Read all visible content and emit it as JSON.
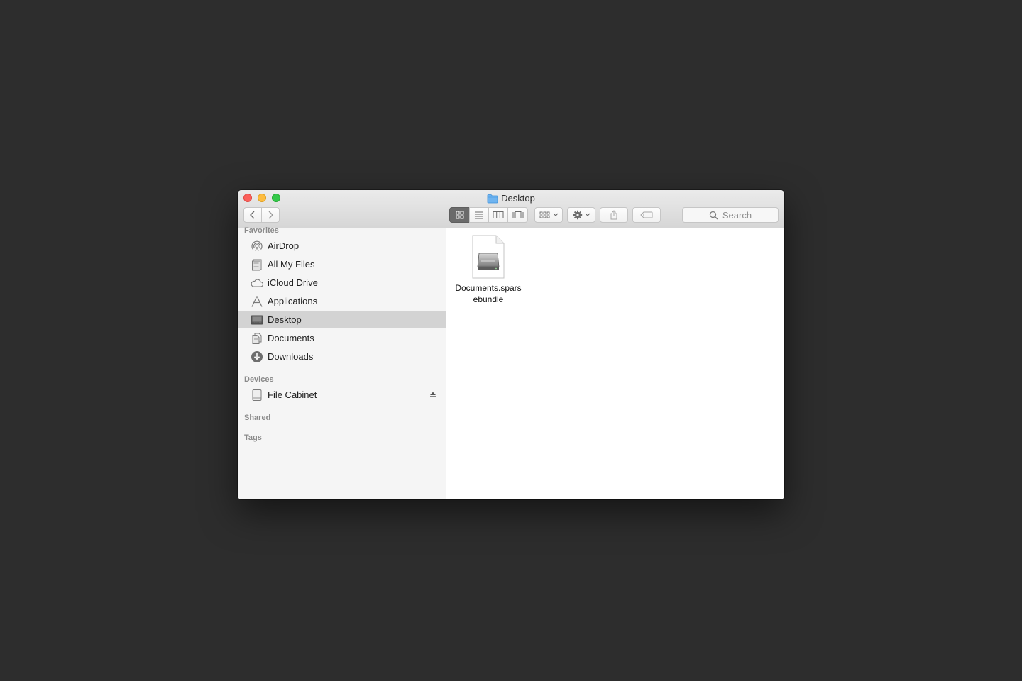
{
  "window": {
    "title": "Desktop",
    "search_placeholder": "Search"
  },
  "toolbar": {
    "view_modes": [
      "icon-view",
      "list-view",
      "column-view",
      "cover-flow-view"
    ],
    "active_view": "icon-view"
  },
  "sidebar": {
    "favorites_header": "Favorites",
    "favorites": [
      {
        "label": "AirDrop",
        "icon": "airdrop-icon"
      },
      {
        "label": "All My Files",
        "icon": "all-my-files-icon"
      },
      {
        "label": "iCloud Drive",
        "icon": "cloud-icon"
      },
      {
        "label": "Applications",
        "icon": "applications-icon"
      },
      {
        "label": "Desktop",
        "icon": "desktop-icon",
        "selected": true
      },
      {
        "label": "Documents",
        "icon": "documents-icon"
      },
      {
        "label": "Downloads",
        "icon": "downloads-icon"
      }
    ],
    "devices_header": "Devices",
    "devices": [
      {
        "label": "File Cabinet",
        "icon": "disk-icon",
        "ejectable": true
      }
    ],
    "shared_header": "Shared",
    "tags_header": "Tags"
  },
  "content": {
    "files": [
      {
        "name": "Documents.sparsebundle",
        "display_line1": "Documents.spars",
        "display_line2": "ebundle",
        "icon": "disk-image-icon"
      }
    ]
  },
  "colors": {
    "desktop_bg": "#2d2d2d",
    "selection": "#d3d3d3",
    "close": "#fc605b",
    "minimize": "#fdbc40",
    "maximize": "#34c84a"
  }
}
